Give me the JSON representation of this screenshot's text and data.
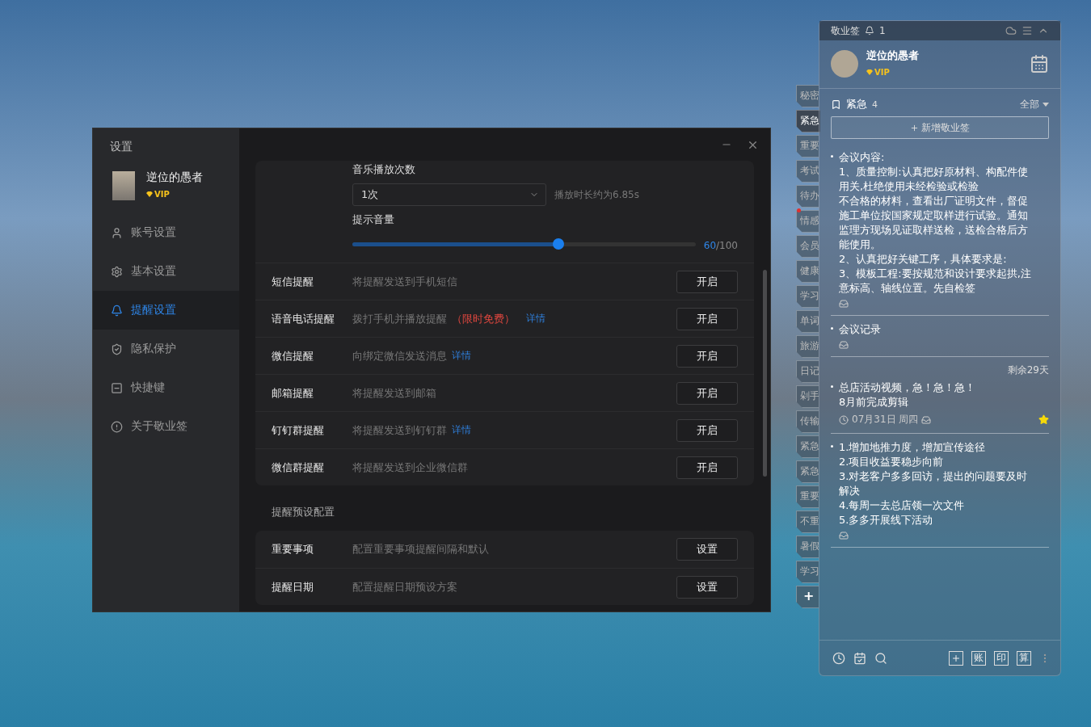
{
  "settings": {
    "title": "设置",
    "user": {
      "name": "逆位的愚者",
      "badge": "VIP"
    },
    "nav": [
      {
        "label": "账号设置",
        "selected": false
      },
      {
        "label": "基本设置",
        "selected": false
      },
      {
        "label": "提醒设置",
        "selected": true
      },
      {
        "label": "隐私保护",
        "selected": false
      },
      {
        "label": "快捷键",
        "selected": false
      },
      {
        "label": "关于敬业签",
        "selected": false
      }
    ],
    "music": {
      "label": "音乐播放次数",
      "value": "1次",
      "hint": "播放时长约为6.85s"
    },
    "volume": {
      "label": "提示音量",
      "level": 0.6,
      "reading": "60",
      "maximum": "/100"
    },
    "channels": [
      {
        "name": "短信提醒",
        "description": "将提醒发送到手机短信",
        "button": "开启"
      },
      {
        "name": "语音电话提醒",
        "description": "拨打手机并播放提醒",
        "tag": "（限时免费）",
        "link": "详情",
        "button": "开启"
      },
      {
        "name": "微信提醒",
        "description": "向绑定微信发送消息",
        "link": "详情",
        "button": "开启"
      },
      {
        "name": "邮箱提醒",
        "description": "将提醒发送到邮箱",
        "button": "开启"
      },
      {
        "name": "钉钉群提醒",
        "description": "将提醒发送到钉钉群",
        "link": "详情",
        "button": "开启"
      },
      {
        "name": "微信群提醒",
        "description": "将提醒发送到企业微信群",
        "button": "开启"
      }
    ],
    "presets_title": "提醒预设配置",
    "presets": [
      {
        "name": "重要事项",
        "description": "配置重要事项提醒间隔和默认",
        "button": "设置"
      },
      {
        "name": "提醒日期",
        "description": "配置提醒日期预设方案",
        "button": "设置"
      }
    ]
  },
  "notes_app": {
    "title": "敬业签",
    "notification_count": "1",
    "user": {
      "name": "逆位的愚者",
      "badge": "VIP"
    },
    "category": {
      "name": "紧急",
      "count": "4"
    },
    "filter": "全部",
    "add_button": "新增敬业签",
    "notes": [
      {
        "lines": [
          "会议内容:",
          "1、质量控制:认真把好原材料、构配件使用关,杜绝使用未经检验或检验",
          "不合格的材料，查看出厂证明文件，督促施工单位按国家规定取样进行试验。通知监理方现场见证取样送检，送检合格后方能使用。",
          "2、认真把好关键工序，具体要求是:",
          "3、模板工程:要按规范和设计要求起拱,注意标高、轴线位置。先自检签"
        ],
        "starred": false
      },
      {
        "lines": [
          "会议记录"
        ],
        "starred": false
      },
      {
        "lines": [
          "总店活动视频，急！急！急！",
          "8月前完成剪辑"
        ],
        "deadline": "剩余29天",
        "date": "07月31日 周四",
        "starred": true
      },
      {
        "lines": [
          "1.增加地推力度，增加宣传途径",
          "2.项目收益要稳步向前",
          "3.对老客户多多回访，提出的问题要及时解决",
          "4.每周一去总店领一次文件",
          "5.多多开展线下活动"
        ],
        "starred": false
      }
    ],
    "side_tabs": [
      {
        "label": "秘密",
        "selected": false,
        "unread": false
      },
      {
        "label": "紧急",
        "selected": true,
        "unread": false
      },
      {
        "label": "重要",
        "selected": false,
        "unread": false
      },
      {
        "label": "考试",
        "selected": false,
        "unread": false
      },
      {
        "label": "待办",
        "selected": false,
        "unread": false
      },
      {
        "label": "情感",
        "selected": false,
        "unread": true
      },
      {
        "label": "会员",
        "selected": false,
        "unread": false
      },
      {
        "label": "健康",
        "selected": false,
        "unread": false
      },
      {
        "label": "学习",
        "selected": false,
        "unread": false
      },
      {
        "label": "单词",
        "selected": false,
        "unread": false
      },
      {
        "label": "旅游",
        "selected": false,
        "unread": false
      },
      {
        "label": "日记",
        "selected": false,
        "unread": false
      },
      {
        "label": "剁手",
        "selected": false,
        "unread": false
      },
      {
        "label": "传输",
        "selected": false,
        "unread": false
      },
      {
        "label": "紧急",
        "selected": false,
        "unread": false
      },
      {
        "label": "紧急",
        "selected": false,
        "unread": false
      },
      {
        "label": "重要",
        "selected": false,
        "unread": false
      },
      {
        "label": "不重",
        "selected": false,
        "unread": false
      },
      {
        "label": "暑假",
        "selected": false,
        "unread": false
      },
      {
        "label": "学习",
        "selected": false,
        "unread": false
      }
    ],
    "add_tab": "+",
    "tool_buttons": [
      "账",
      "印",
      "算"
    ]
  }
}
